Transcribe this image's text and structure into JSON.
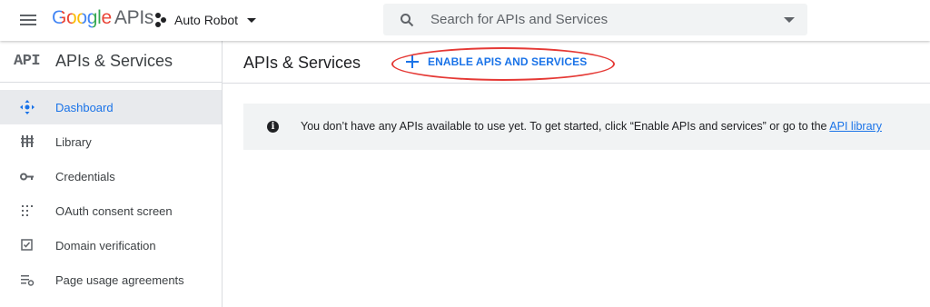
{
  "header": {
    "logo_google": "Google",
    "logo_apis": "APIs",
    "project_name": "Auto Robot",
    "search_placeholder": "Search for APIs and Services"
  },
  "sidebar": {
    "icon_text": "API",
    "title": "APIs & Services",
    "items": [
      {
        "label": "Dashboard",
        "icon": "dashboard-icon",
        "active": true
      },
      {
        "label": "Library",
        "icon": "library-icon",
        "active": false
      },
      {
        "label": "Credentials",
        "icon": "key-icon",
        "active": false
      },
      {
        "label": "OAuth consent screen",
        "icon": "oauth-icon",
        "active": false
      },
      {
        "label": "Domain verification",
        "icon": "checkbox-icon",
        "active": false
      },
      {
        "label": "Page usage agreements",
        "icon": "settings-list-icon",
        "active": false
      }
    ]
  },
  "main": {
    "title": "APIs & Services",
    "enable_button_label": "ENABLE APIS AND SERVICES",
    "notice_text": "You don’t have any APIs available to use yet. To get started, click “Enable APIs and services” or go to the ",
    "notice_link": "API library"
  },
  "colors": {
    "accent": "#1a73e8",
    "highlight_oval": "#e53935",
    "active_bg": "#e8eaed"
  }
}
